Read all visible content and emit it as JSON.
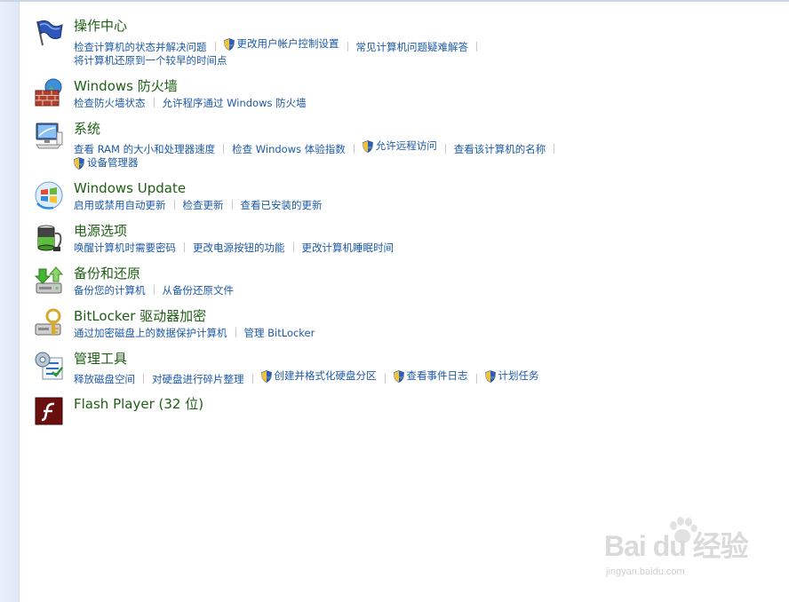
{
  "sections": [
    {
      "id": "action-center",
      "title": "操作中心",
      "icon": "flag-icon",
      "rows": [
        [
          {
            "label": "检查计算机的状态并解决问题",
            "shield": false
          },
          {
            "label": "更改用户帐户控制设置",
            "shield": true
          },
          {
            "label": "常见计算机问题疑难解答",
            "shield": false
          }
        ],
        [
          {
            "label": "将计算机还原到一个较早的时间点",
            "shield": false
          }
        ]
      ]
    },
    {
      "id": "firewall",
      "title": "Windows 防火墙",
      "icon": "firewall-icon",
      "rows": [
        [
          {
            "label": "检查防火墙状态",
            "shield": false
          },
          {
            "label": "允许程序通过 Windows 防火墙",
            "shield": false
          }
        ]
      ]
    },
    {
      "id": "system",
      "title": "系统",
      "icon": "system-computer-icon",
      "rows": [
        [
          {
            "label": "查看 RAM 的大小和处理器速度",
            "shield": false
          },
          {
            "label": "检查 Windows 体验指数",
            "shield": false
          },
          {
            "label": "允许远程访问",
            "shield": true
          },
          {
            "label": "查看该计算机的名称",
            "shield": false
          }
        ],
        [
          {
            "label": "设备管理器",
            "shield": true
          }
        ]
      ]
    },
    {
      "id": "windows-update",
      "title": "Windows Update",
      "icon": "windows-update-icon",
      "rows": [
        [
          {
            "label": "启用或禁用自动更新",
            "shield": false
          },
          {
            "label": "检查更新",
            "shield": false
          },
          {
            "label": "查看已安装的更新",
            "shield": false
          }
        ]
      ]
    },
    {
      "id": "power",
      "title": "电源选项",
      "icon": "battery-power-icon",
      "rows": [
        [
          {
            "label": "唤醒计算机时需要密码",
            "shield": false
          },
          {
            "label": "更改电源按钮的功能",
            "shield": false
          },
          {
            "label": "更改计算机睡眠时间",
            "shield": false
          }
        ]
      ]
    },
    {
      "id": "backup",
      "title": "备份和还原",
      "icon": "backup-restore-icon",
      "rows": [
        [
          {
            "label": "备份您的计算机",
            "shield": false
          },
          {
            "label": "从备份还原文件",
            "shield": false
          }
        ]
      ]
    },
    {
      "id": "bitlocker",
      "title": "BitLocker 驱动器加密",
      "icon": "bitlocker-key-icon",
      "rows": [
        [
          {
            "label": "通过加密磁盘上的数据保护计算机",
            "shield": false
          },
          {
            "label": "管理 BitLocker",
            "shield": false
          }
        ]
      ]
    },
    {
      "id": "admin-tools",
      "title": "管理工具",
      "icon": "admin-tools-icon",
      "rows": [
        [
          {
            "label": "释放磁盘空间",
            "shield": false
          },
          {
            "label": "对硬盘进行碎片整理",
            "shield": false
          },
          {
            "label": "创建并格式化硬盘分区",
            "shield": true
          },
          {
            "label": "查看事件日志",
            "shield": true
          },
          {
            "label": "计划任务",
            "shield": true
          }
        ]
      ]
    },
    {
      "id": "flash",
      "title": "Flash Player (32 位)",
      "icon": "flash-player-icon",
      "rows": []
    }
  ],
  "watermark": {
    "logo": "Bai du 经验",
    "url": "jingyan.baidu.com"
  },
  "colors": {
    "title": "#1e5f14",
    "link": "#1d5aa6",
    "left_pane": "#e3ecf7",
    "separator": "#c8c8c8"
  }
}
